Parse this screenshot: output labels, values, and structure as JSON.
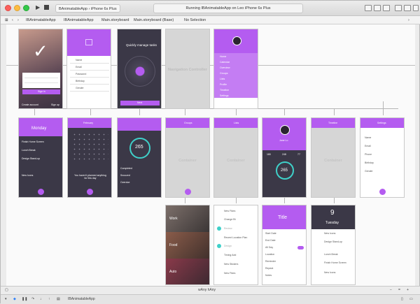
{
  "toolbar": {
    "scheme_target": "BAnimatableApp",
    "scheme_device": "iPhone 6s Plus",
    "status_text": "Running IBAnimatableApp on Leo iPhone 6s Plus"
  },
  "jumpbar": {
    "project": "IBAnimatableApp",
    "group": "IBAnimatableApp",
    "file": "Main.storyboard",
    "storyboard_base": "Main.storyboard (Base)",
    "selection": "No Selection"
  },
  "size_class": "wAny hAny",
  "debug_target": "IBAnimatableApp",
  "scenes": {
    "onboarding": {
      "button": "Sign in",
      "bottom_left": "Create account",
      "bottom_right": "Sign up"
    },
    "signup": {
      "fields": [
        "Name",
        "Email",
        "Password",
        "Birthday",
        "Gender"
      ]
    },
    "tour": {
      "headline": "Quickly manage tasks",
      "button": "Next"
    },
    "navigation": {
      "label": "Navigation Controller"
    },
    "menu": {
      "items": [
        "Home",
        "Calendar",
        "Overview",
        "Groups",
        "Lists",
        "Profile",
        "Timeline",
        "Settings"
      ]
    },
    "home": {
      "title": "Monday",
      "tasks": [
        "Finish Home Screen",
        "Lunch Break",
        "Design Stand-up",
        "New Icons"
      ]
    },
    "calendar": {
      "month": "February",
      "empty": "You haven't planned anything for this day"
    },
    "overview": {
      "count": "265",
      "rows": [
        "Completed",
        "Snoozed",
        "Overdue"
      ]
    },
    "groups": {
      "title": "Groups",
      "label": "Container"
    },
    "lists": {
      "title": "Lists",
      "label": "Container"
    },
    "profile": {
      "name": "Jane Lo",
      "stats": [
        "180",
        "248",
        "77"
      ],
      "count": "265"
    },
    "timeline": {
      "title": "Timeline",
      "label": "Container"
    },
    "settings": {
      "title": "Settings",
      "rows": [
        "Name",
        "Email",
        "Phone",
        "Birthday",
        "Gender"
      ]
    },
    "group_cards": {
      "items": [
        "Work",
        "Food",
        "Auto"
      ]
    },
    "task_list": {
      "items": [
        "New Fikes",
        "Change Bt",
        "Review",
        "Recent Location Plan",
        "Design",
        "Timing Add",
        "New Stickers",
        "New Fikes"
      ]
    },
    "add_item": {
      "title": "Title",
      "rows": [
        "Start Date",
        "End Date",
        "All Day",
        "Location",
        "Reminder",
        "Repeat",
        "Notes"
      ]
    },
    "day_view": {
      "day": "9",
      "weekday": "Tuesday",
      "events": [
        "New Icons",
        "Design Stand-up",
        "Lunch Break",
        "Finish Home Screen",
        "New Icons"
      ]
    }
  }
}
